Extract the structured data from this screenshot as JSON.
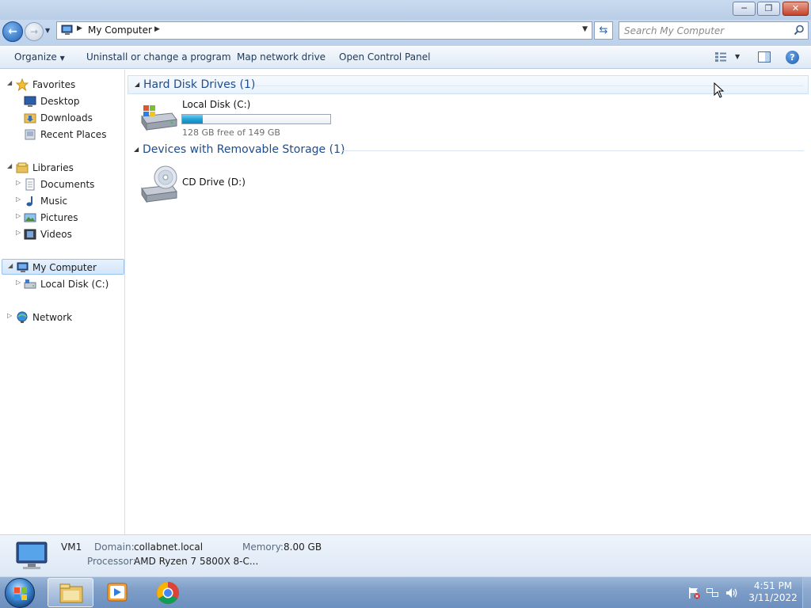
{
  "window": {
    "title_buttons": {
      "minimize_icon": "minimize-icon",
      "maximize_icon": "restore-icon",
      "close_icon": "close-icon"
    }
  },
  "address_bar": {
    "breadcrumb": "My Computer",
    "search_placeholder": "Search My Computer"
  },
  "toolbar": {
    "organize": "Organize",
    "uninstall": "Uninstall or change a program",
    "map_drive": "Map network drive",
    "control_panel": "Open Control Panel"
  },
  "nav": {
    "favorites": "Favorites",
    "desktop": "Desktop",
    "downloads": "Downloads",
    "recent": "Recent Places",
    "libraries": "Libraries",
    "documents": "Documents",
    "music": "Music",
    "pictures": "Pictures",
    "videos": "Videos",
    "my_computer": "My Computer",
    "local_disk": "Local Disk (C:)",
    "network": "Network"
  },
  "content": {
    "group_hdd": "Hard Disk Drives (1)",
    "group_removable": "Devices with Removable Storage (1)",
    "drive_c": {
      "name": "Local Disk (C:)",
      "free_text": "128 GB free of 149 GB",
      "used_fraction": 0.14
    },
    "drive_d": {
      "name": "CD Drive (D:)"
    }
  },
  "details": {
    "name": "VM1",
    "domain_label": "Domain:",
    "domain_value": "collabnet.local",
    "memory_label": "Memory:",
    "memory_value": "8.00 GB",
    "processor_label": "Processor:",
    "processor_value": "AMD Ryzen 7 5800X 8-C..."
  },
  "taskbar": {
    "time": "4:51 PM",
    "date": "3/11/2022"
  },
  "colors": {
    "accent": "#1e4c8c",
    "progress": "#1fa0d4",
    "taskbar": "#7f9ec8"
  }
}
